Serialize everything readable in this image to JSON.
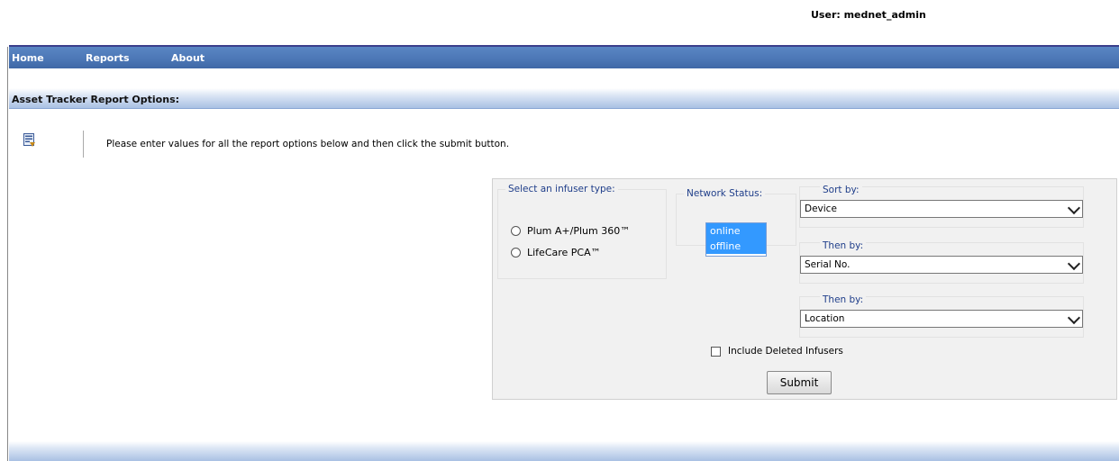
{
  "header": {
    "user_label": "User: mednet_admin"
  },
  "nav": {
    "items": [
      "Home",
      "Reports",
      "About"
    ]
  },
  "section": {
    "title": "Asset Tracker Report Options:",
    "icon": "report-options-icon",
    "instructions": "Please enter values for all the report options below and then click the submit button."
  },
  "form": {
    "infuser_type": {
      "legend": "Select an infuser type:",
      "options": [
        "Plum A+/Plum 360™",
        "LifeCare PCA™"
      ]
    },
    "network_status": {
      "legend": "Network Status:",
      "options": [
        "online",
        "offline"
      ],
      "selection_color": "#3399ff"
    },
    "sort_by": {
      "legend": "Sort by:",
      "selected": "Device"
    },
    "then_by_1": {
      "legend": "Then by:",
      "selected": "Serial No."
    },
    "then_by_2": {
      "legend": "Then by:",
      "selected": "Location"
    },
    "include_deleted_label": "Include Deleted Infusers",
    "submit_label": "Submit"
  },
  "colors": {
    "nav_bar": "#4b76b5",
    "legend_text": "#1f3e8a",
    "panel_bg": "#f1f1f1"
  }
}
